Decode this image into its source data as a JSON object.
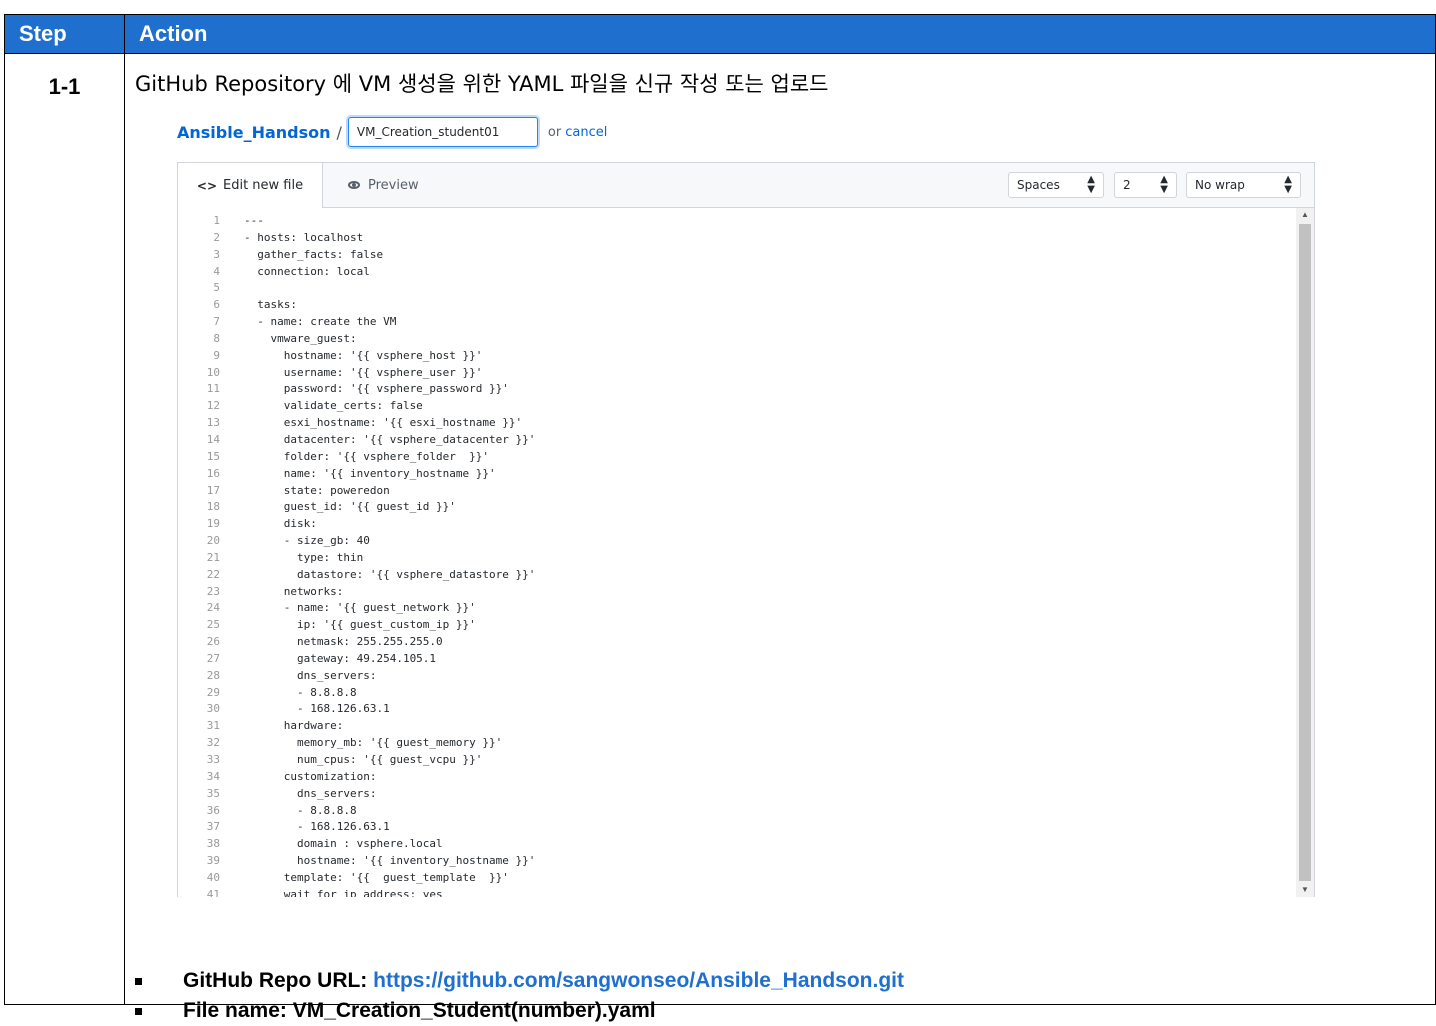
{
  "table": {
    "header_step": "Step",
    "header_action": "Action",
    "header_color": "#1f6fcf"
  },
  "row": {
    "step": "1-1",
    "title": "GitHub Repository 에 VM 생성을 위한 YAML 파일을 신규 작성 또는 업로드"
  },
  "github": {
    "repo_name": "Ansible_Handson",
    "separator": "/",
    "filename_value": "VM_Creation_student01",
    "or_text": "or",
    "cancel_label": "cancel",
    "tab_edit_icon": "<>",
    "tab_edit_label": "Edit new file",
    "tab_preview_label": "Preview",
    "indent_mode": "Spaces",
    "indent_size": "2",
    "wrap_mode": "No wrap"
  },
  "code_lines": [
    "---",
    "- hosts: localhost",
    "  gather_facts: false",
    "  connection: local",
    "",
    "  tasks:",
    "  - name: create the VM",
    "    vmware_guest:",
    "      hostname: '{{ vsphere_host }}'",
    "      username: '{{ vsphere_user }}'",
    "      password: '{{ vsphere_password }}'",
    "      validate_certs: false",
    "      esxi_hostname: '{{ esxi_hostname }}'",
    "      datacenter: '{{ vsphere_datacenter }}'",
    "      folder: '{{ vsphere_folder  }}'",
    "      name: '{{ inventory_hostname }}'",
    "      state: poweredon",
    "      guest_id: '{{ guest_id }}'",
    "      disk:",
    "      - size_gb: 40",
    "        type: thin",
    "        datastore: '{{ vsphere_datastore }}'",
    "      networks:",
    "      - name: '{{ guest_network }}'",
    "        ip: '{{ guest_custom_ip }}'",
    "        netmask: 255.255.255.0",
    "        gateway: 49.254.105.1",
    "        dns_servers:",
    "        - 8.8.8.8",
    "        - 168.126.63.1",
    "      hardware:",
    "        memory_mb: '{{ guest_memory }}'",
    "        num_cpus: '{{ guest_vcpu }}'",
    "      customization:",
    "        dns_servers:",
    "        - 8.8.8.8",
    "        - 168.126.63.1",
    "        domain : vsphere.local",
    "        hostname: '{{ inventory_hostname }}'",
    "      template: '{{  guest_template  }}'",
    "      wait_for_ip_address: yes"
  ],
  "notes": {
    "repo_label": "GitHub Repo URL: ",
    "repo_url": "https://github.com/sangwonseo/Ansible_Handson.git",
    "file_label": "File name: VM_Creation_Student(number).yaml"
  }
}
